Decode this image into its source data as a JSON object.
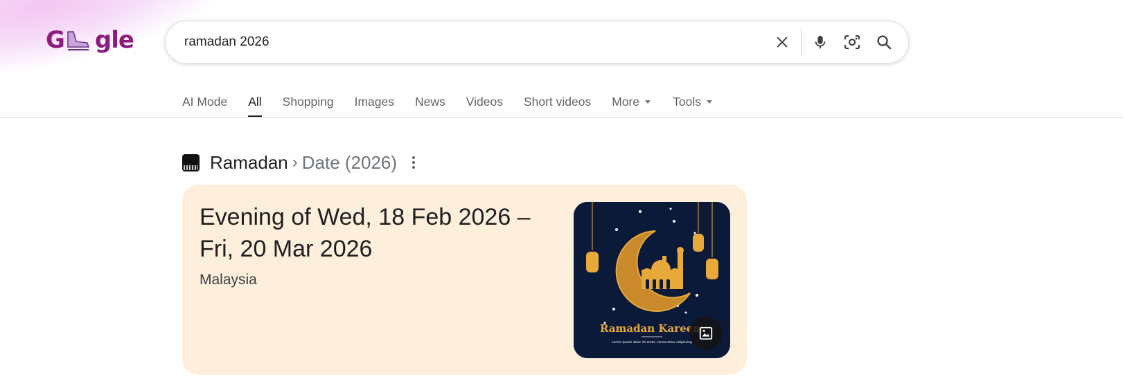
{
  "logo": {
    "text": "Gogle",
    "alt": "Google Doodle"
  },
  "search": {
    "query": "ramadan 2026"
  },
  "tabs": [
    {
      "label": "AI Mode",
      "active": false
    },
    {
      "label": "All",
      "active": true
    },
    {
      "label": "Shopping",
      "active": false
    },
    {
      "label": "Images",
      "active": false
    },
    {
      "label": "News",
      "active": false
    },
    {
      "label": "Videos",
      "active": false
    },
    {
      "label": "Short videos",
      "active": false
    },
    {
      "label": "More",
      "active": false,
      "dropdown": true
    },
    {
      "label": "Tools",
      "active": false,
      "dropdown": true
    }
  ],
  "breadcrumb": {
    "main": "Ramadan",
    "separator": "›",
    "sub": "Date (2026)"
  },
  "card": {
    "date_line1": "Evening of Wed, 18 Feb 2026 –",
    "date_line2": "Fri, 20 Mar 2026",
    "location": "Malaysia",
    "image_caption": "Ramadan Kareem",
    "image_subcaption": "Lorem ipsum dolor sit amet, consectetur adipiscing",
    "background": "#feeedc"
  },
  "colors": {
    "accent": "#8d1b80",
    "card_bg": "#feeedc",
    "thumb_bg": "#0c1a3a",
    "gold": "#e8a93b"
  },
  "icons": {
    "clear": "close-icon",
    "voice": "mic-icon",
    "lens": "lens-icon",
    "search": "search-icon",
    "image": "image-icon",
    "more": "more-vert-icon"
  }
}
